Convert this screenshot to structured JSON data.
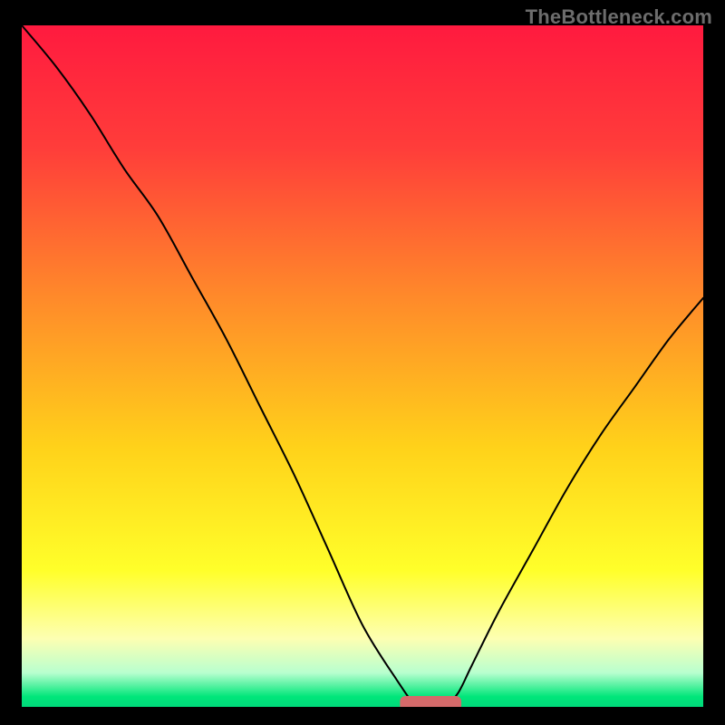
{
  "watermark": "TheBottleneck.com",
  "chart_data": {
    "type": "line",
    "title": "",
    "xlabel": "",
    "ylabel": "",
    "xlim": [
      0,
      100
    ],
    "ylim": [
      0,
      100
    ],
    "x": [
      0,
      5,
      10,
      15,
      20,
      25,
      30,
      35,
      40,
      45,
      50,
      55,
      58,
      60,
      62,
      64,
      66,
      70,
      75,
      80,
      85,
      90,
      95,
      100
    ],
    "y": [
      100,
      94,
      87,
      79,
      72,
      63,
      54,
      44,
      34,
      23,
      12,
      4,
      0,
      0,
      0,
      2,
      6,
      14,
      23,
      32,
      40,
      47,
      54,
      60
    ],
    "background_gradient_stops": [
      {
        "offset": 0.0,
        "color": "#ff1a3f"
      },
      {
        "offset": 0.18,
        "color": "#ff3d3a"
      },
      {
        "offset": 0.4,
        "color": "#ff8a2a"
      },
      {
        "offset": 0.62,
        "color": "#ffd21a"
      },
      {
        "offset": 0.8,
        "color": "#ffff2a"
      },
      {
        "offset": 0.9,
        "color": "#fdffb2"
      },
      {
        "offset": 0.95,
        "color": "#b8ffcf"
      },
      {
        "offset": 0.985,
        "color": "#00e67a"
      },
      {
        "offset": 1.0,
        "color": "#00d97a"
      }
    ],
    "marker": {
      "x_center": 60,
      "y_center": 0.5,
      "width": 9,
      "height": 2.2,
      "color": "#d46a6a"
    }
  }
}
